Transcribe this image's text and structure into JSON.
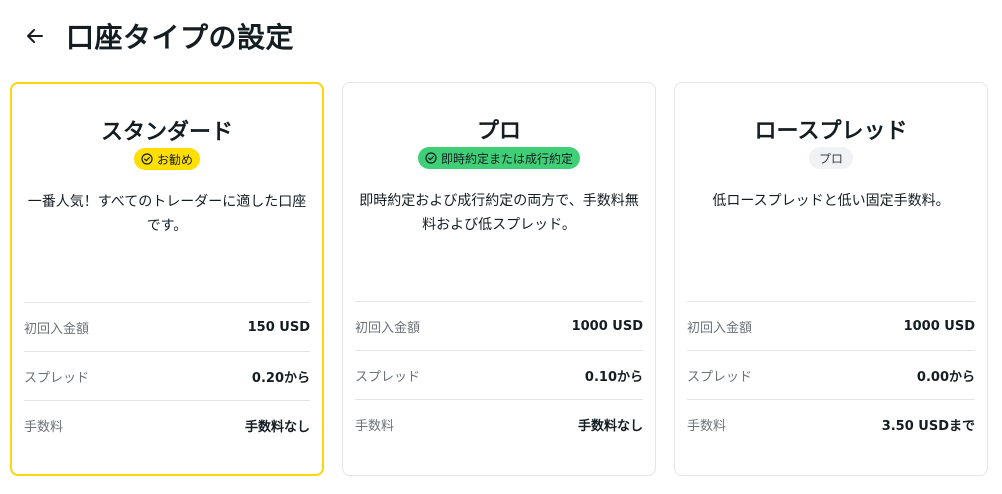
{
  "header": {
    "title": "口座タイプの設定",
    "back_icon": "arrow-left-icon"
  },
  "colors": {
    "selected_border": "#ffd60a",
    "badge_recommended": "#ffde02",
    "badge_execution": "#3fcf77",
    "badge_grey": "#f0f2f4"
  },
  "cards": [
    {
      "title": "スタンダード",
      "badge": "お勧め",
      "badge_icon": "check-circle-icon",
      "description": "一番人気！すべてのトレーダーに適した口座です。",
      "rows": [
        {
          "label": "初回入金額",
          "value": "150 USD"
        },
        {
          "label": "スプレッド",
          "value": "0.20から"
        },
        {
          "label": "手数料",
          "value": "手数料なし"
        }
      ]
    },
    {
      "title": "プロ",
      "badge": "即時約定または成行約定",
      "badge_icon": "check-circle-icon",
      "description": "即時約定および成行約定の両方で、手数料無料および低スプレッド。",
      "rows": [
        {
          "label": "初回入金額",
          "value": "1000 USD"
        },
        {
          "label": "スプレッド",
          "value": "0.10から"
        },
        {
          "label": "手数料",
          "value": "手数料なし"
        }
      ]
    },
    {
      "title": "ロースプレッド",
      "badge": "プロ",
      "description": "低ロースプレッドと低い固定手数料。",
      "rows": [
        {
          "label": "初回入金額",
          "value": "1000 USD"
        },
        {
          "label": "スプレッド",
          "value": "0.00から"
        },
        {
          "label": "手数料",
          "value": "3.50 USDまで"
        }
      ]
    }
  ]
}
